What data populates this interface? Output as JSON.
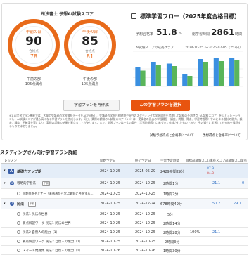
{
  "score": {
    "title": "司法書士 予想AI試験スコア",
    "morning": {
      "label": "午前の部",
      "value": "90",
      "pass_label": "合格点",
      "pass_value": "78",
      "under_label": "午前の部",
      "under_value": "105点満点"
    },
    "afternoon": {
      "label": "午後の部",
      "value": "85",
      "pass_label": "合格点",
      "pass_value": "81",
      "under_label": "午後の部",
      "under_value": "105点満点"
    },
    "arc_color": "#e86a1a"
  },
  "plan": {
    "title": "標準学習フロー（2025年度合格目標）",
    "progress_label": "予想合格率",
    "progress_value": "51.8",
    "progress_unit": "%",
    "hours_label": "総学習時間",
    "hours_value": "2861",
    "hours_unit": "時間",
    "chart_title": "AI試験スコアの成長グラフ",
    "chart_range": "2024-10-25 ～ 2025-07-05（253日）"
  },
  "chart_data": {
    "type": "bar",
    "categories": [
      "",
      "",
      "",
      "",
      "",
      "",
      ""
    ],
    "series": [
      {
        "name": "",
        "values": [
          55,
          70,
          65,
          35,
          78,
          80,
          82
        ]
      },
      {
        "name": "",
        "values": [
          45,
          60,
          58,
          30,
          70,
          72,
          76
        ]
      }
    ],
    "colors": [
      "#3a8fe0",
      "#5ab55a"
    ],
    "ylim": [
      0,
      100
    ],
    "grid": true
  },
  "buttons": {
    "recreate": "学習プランを再作成",
    "choose": "この学習プランを選択"
  },
  "note": "※1 AI学習プラン機能では、大量の受講者の学習履歴データをAIが分析し、受講者の学習目標時期や現在のスタディングの学習履歴を考慮して試験の予測時点（AI試験スコア）をシミュレーションし、AI試験スコアが最も高くなる学習プランを作成します。同じ、実際の試験のAI試験スコア（※2）は、受講者の過去の学習履歴（講座、問題、得点、学習時間等）やAIによる推計の能力、誤差、精度、不確実性等により、実際の試験の結果と異なることがあります。また、学習プランは一定の条件（学習時間等）に基づいて作成されたものであり、その通りに学習しても合格を保証するものではありません。",
  "links": {
    "score_about": "試験予想得点と合格率について",
    "score_about2": "予想得点と合格率について"
  },
  "table": {
    "title": "スタディングさん向け学習プラン詳細",
    "headers": [
      "レッスン",
      "開始予定日",
      "終了予定日",
      "学習予定時間",
      "目標AI試験スコア",
      "講座スコア",
      "AI試験スコア",
      "得点"
    ],
    "rows": [
      {
        "badge": "A",
        "name": "基礎力アップ期",
        "start": "2024-10-25",
        "end": "2025-05-29",
        "time": "2429時間29分",
        "score_a": "87.9",
        "score_b": "84.8",
        "style": "blue"
      },
      {
        "badge": "1",
        "name": "戦略的学習法",
        "tag": "午前",
        "start": "2024-10-25",
        "end": "2024-10-25",
        "time": "2時間1分",
        "ai": "21.1",
        "pt": "0",
        "style": "light"
      },
      {
        "name": "短期合格セミナー「未熟者から学ぶ最短に合格する…」",
        "start": "2024-10-25",
        "end": "2024-10-25",
        "time": "1時間7分",
        "style": "plain"
      },
      {
        "badge": "2",
        "name": "民法",
        "tag": "午前",
        "start": "2024-10-25",
        "end": "2024-12-24",
        "time": "678時間49分",
        "ai": "50.2",
        "pt": "29.1",
        "style": "light"
      },
      {
        "name": "民法1 民法の世界",
        "start": "2024-10-25",
        "end": "2024-10-25",
        "time": "5分",
        "style": "plain"
      },
      {
        "name": "要点解説ワーク 民法1 民法の世界",
        "start": "2024-10-25",
        "end": "2024-10-25",
        "time": "2時間14分",
        "style": "plain"
      },
      {
        "name": "民法2 自然人の能力（1）",
        "start": "2024-10-25",
        "end": "2024-10-25",
        "time": "2時間28分",
        "ai2": "100%",
        "ai3": "21.1",
        "style": "plain"
      },
      {
        "name": "要点解説ワーク 民法2 自然人の能力（1）",
        "start": "2024-10-25",
        "end": "2024-10-25",
        "time": "2時間3分",
        "style": "plain"
      },
      {
        "name": "スマート問題集 民法2 自然人の能力（1）",
        "start": "2024-10-26",
        "end": "2024-10-26",
        "time": "1時間30分",
        "style": "plain"
      }
    ]
  }
}
